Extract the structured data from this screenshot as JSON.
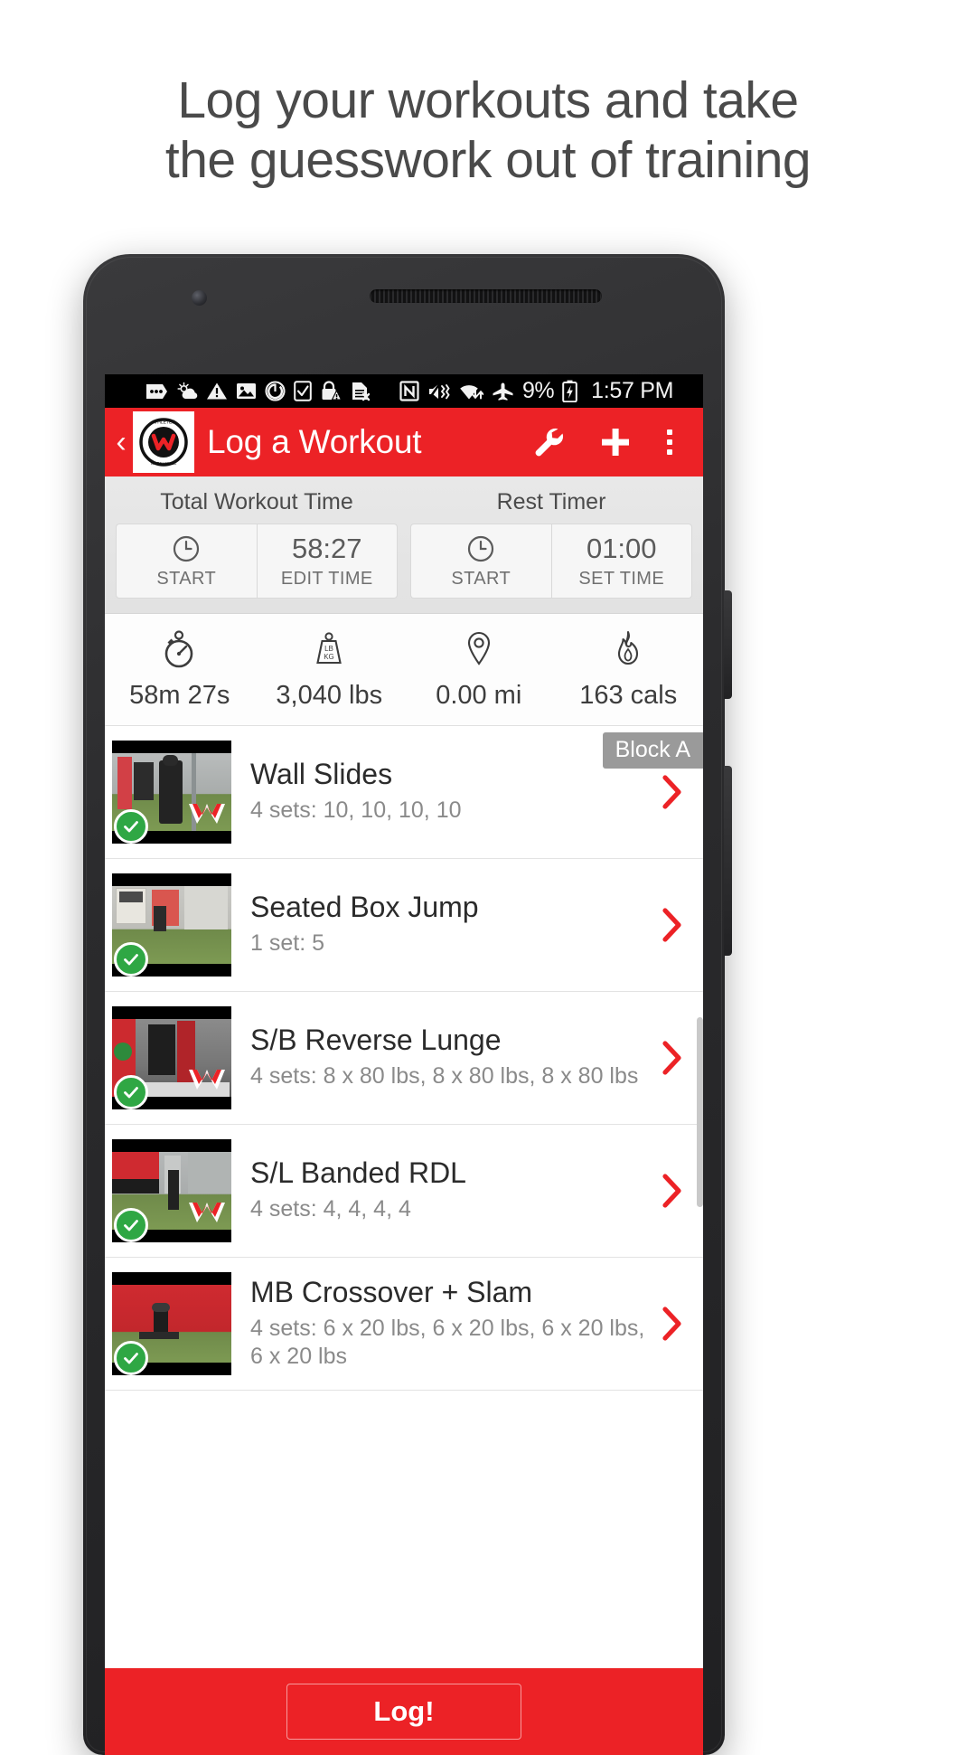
{
  "promo": {
    "line1": "Log your workouts and take",
    "line2": "the guesswork out of training"
  },
  "statusbar": {
    "icons": [
      "messages-icon",
      "weather-icon",
      "warning-icon",
      "photo-icon",
      "power-icon",
      "checkbox-icon",
      "lock-warning-icon",
      "sim-error-icon",
      "nfc-icon",
      "vibrate-off-icon",
      "wifi-transfer-icon",
      "airplane-mode-icon",
      "battery-charging-icon"
    ],
    "battery_percent": "9%",
    "time": "1:57 PM"
  },
  "appbar": {
    "back_label": "‹",
    "logo_name": "athletes-warehouse-logo",
    "title": "Log a Workout",
    "actions": [
      {
        "name": "wrench-icon",
        "label": "Settings"
      },
      {
        "name": "plus-icon",
        "label": "Add"
      },
      {
        "name": "overflow-menu-icon",
        "label": "More options"
      }
    ]
  },
  "timers": [
    {
      "caption": "Total Workout Time",
      "start_icon": "clock-icon",
      "start_label": "START",
      "value": "58:27",
      "value_label": "EDIT TIME"
    },
    {
      "caption": "Rest Timer",
      "start_icon": "clock-icon",
      "start_label": "START",
      "value": "01:00",
      "value_label": "SET TIME"
    }
  ],
  "stats": [
    {
      "icon": "stopwatch-icon",
      "value": "58m 27s"
    },
    {
      "icon": "weight-icon",
      "value": "3,040 lbs"
    },
    {
      "icon": "location-pin-icon",
      "value": "0.00 mi"
    },
    {
      "icon": "flame-icon",
      "value": "163 cals"
    }
  ],
  "block_badge": "Block A",
  "exercises": [
    {
      "name": "Wall Slides",
      "sets": "4 sets: 10, 10, 10, 10",
      "completed": true
    },
    {
      "name": "Seated Box Jump",
      "sets": "1 set: 5",
      "completed": true
    },
    {
      "name": "S/B Reverse Lunge",
      "sets": "4 sets: 8 x 80 lbs, 8 x 80 lbs, 8 x 80 lbs",
      "completed": true
    },
    {
      "name": "S/L Banded RDL",
      "sets": "4 sets: 4, 4, 4, 4",
      "completed": true
    },
    {
      "name": "MB Crossover + Slam",
      "sets": "4 sets: 6 x 20 lbs, 6 x 20 lbs, 6 x 20 lbs, 6 x 20 lbs",
      "completed": true
    }
  ],
  "footer": {
    "log_label": "Log!"
  },
  "colors": {
    "brand_red": "#ec2226",
    "check_green": "#2fa744",
    "badge_gray": "#9a9a9a"
  }
}
